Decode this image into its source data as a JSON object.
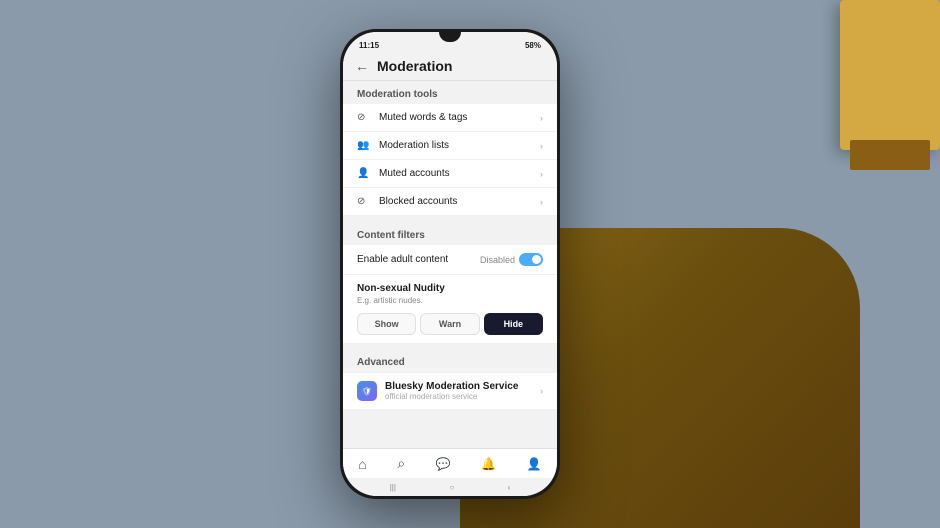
{
  "background": {
    "color": "#8a9aaa"
  },
  "phone": {
    "status_bar": {
      "time": "11:15",
      "battery": "58%",
      "signal": "●●●"
    },
    "header": {
      "title": "Moderation",
      "back_label": "←"
    },
    "moderation_tools": {
      "section_label": "Moderation tools",
      "items": [
        {
          "icon": "filter-icon",
          "label": "Muted words & tags"
        },
        {
          "icon": "people-icon",
          "label": "Moderation lists"
        },
        {
          "icon": "person-icon",
          "label": "Muted accounts"
        },
        {
          "icon": "block-icon",
          "label": "Blocked accounts"
        }
      ]
    },
    "content_filters": {
      "section_label": "Content filters",
      "adult_content": {
        "label": "Enable adult content",
        "status": "Disabled"
      },
      "nudity": {
        "title": "Non-sexual Nudity",
        "description": "E.g. artistic nudes.",
        "options": [
          "Show",
          "Warn",
          "Hide"
        ],
        "active": "Hide"
      }
    },
    "advanced": {
      "section_label": "Advanced",
      "service": {
        "name": "Bluesky Moderation Service",
        "sub": "official moderation service"
      }
    },
    "bottom_nav": {
      "items": [
        {
          "icon": "home-icon",
          "symbol": "⌂"
        },
        {
          "icon": "search-icon",
          "symbol": "⌕"
        },
        {
          "icon": "chat-icon",
          "symbol": "💬"
        },
        {
          "icon": "bell-icon",
          "symbol": "🔔"
        },
        {
          "icon": "profile-icon",
          "symbol": "👤"
        }
      ]
    },
    "gesture_bar": {
      "items": [
        "|||",
        "○",
        "‹"
      ]
    }
  }
}
